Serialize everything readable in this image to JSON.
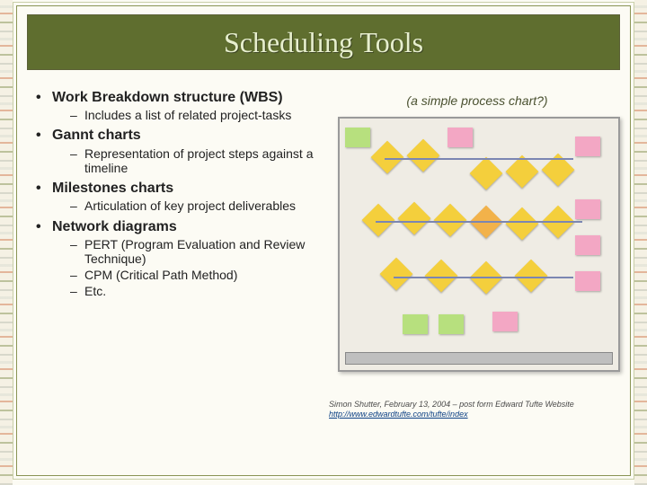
{
  "title": "Scheduling Tools",
  "figure": {
    "caption": "(a simple process chart?)",
    "credit_line1": "Simon Shutter, February 13, 2004 – post form Edward Tufte Website",
    "credit_link_text": "http://www.edwardtufte.com/tufte/index"
  },
  "bullets": {
    "b1": "Work Breakdown structure (WBS)",
    "b1s1": "Includes a list of related project-tasks",
    "b2": "Gannt charts",
    "b2s1": "Representation of project steps against a timeline",
    "b3": "Milestones charts",
    "b3s1": "Articulation of key project deliverables",
    "b4": "Network diagrams",
    "b4s1": "PERT (Program Evaluation and Review Technique)",
    "b4s2": "CPM (Critical Path Method)",
    "b4s3": "Etc."
  }
}
